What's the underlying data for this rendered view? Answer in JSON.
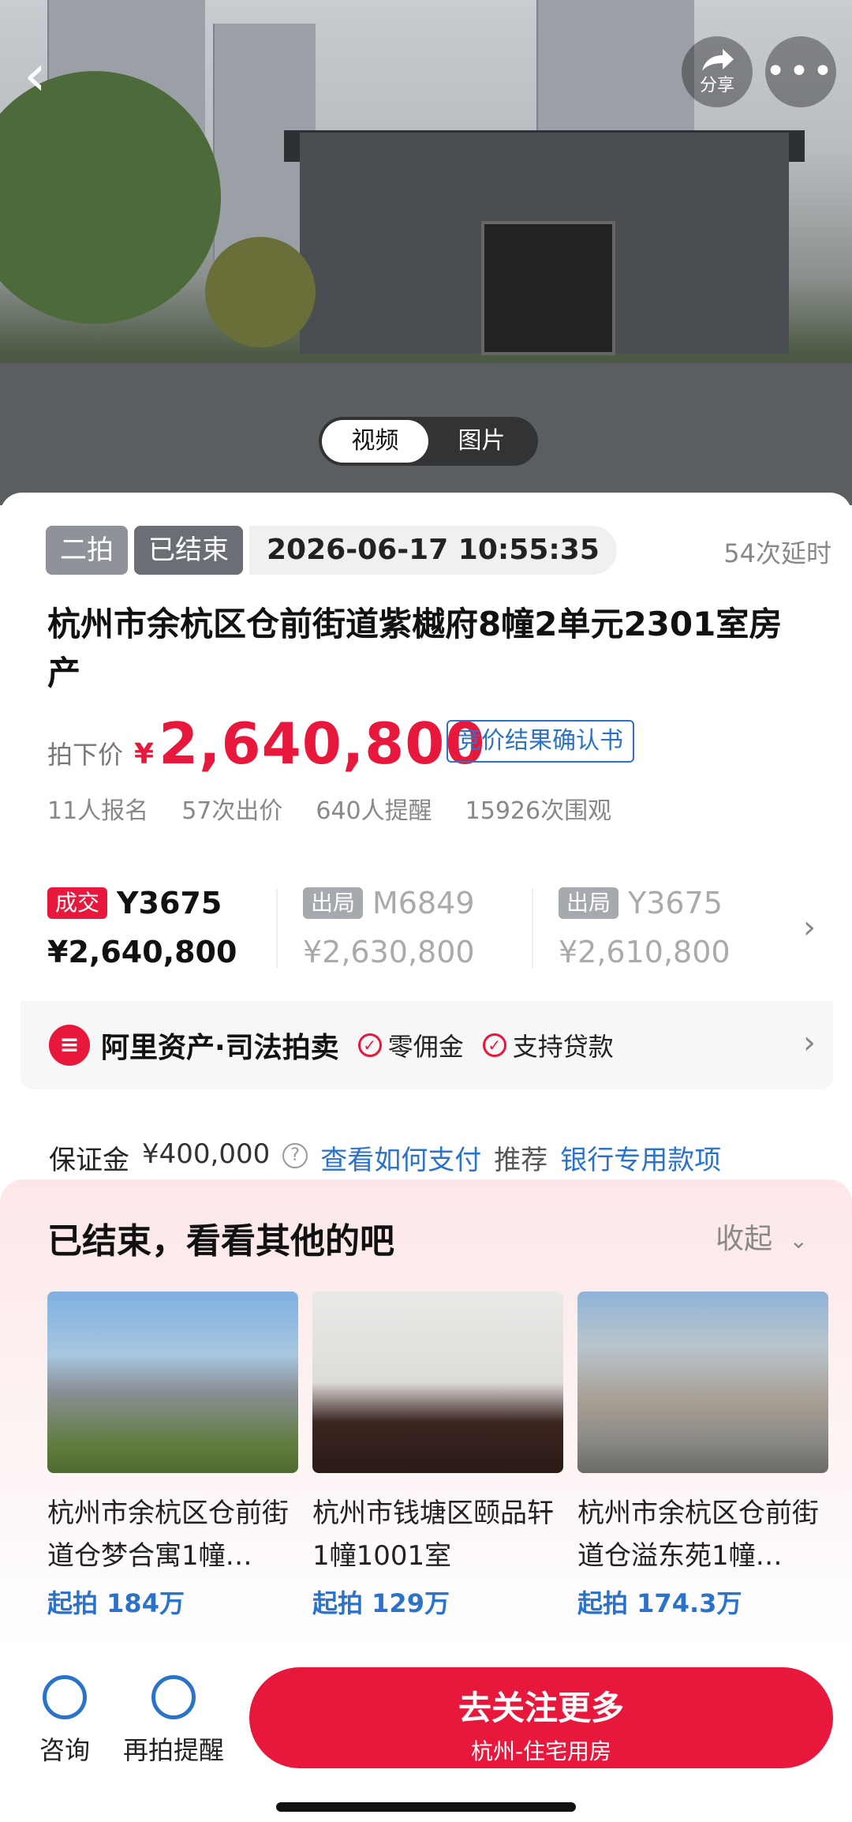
{
  "hero": {
    "share_label": "分享",
    "media_tabs": [
      "视频",
      "图片"
    ]
  },
  "auction": {
    "round_tag": "二拍",
    "status_tag": "已结束",
    "end_time": "2026-06-17 10:55:35",
    "extensions": "54次延时",
    "title": "杭州市余杭区仓前街道紫樾府8幢2单元2301室房产",
    "price_label": "拍下价",
    "currency": "¥",
    "price": "2,640,800",
    "certificate_link": "竞价结果确认书",
    "stats": [
      "11人报名",
      "57次出价",
      "640人提醒",
      "15926次围观"
    ]
  },
  "bids": [
    {
      "badge": "成交",
      "code": "Y3675",
      "price": "¥2,640,800"
    },
    {
      "badge": "出局",
      "code": "M6849",
      "price": "¥2,630,800"
    },
    {
      "badge": "出局",
      "code": "Y3675",
      "price": "¥2,610,800"
    }
  ],
  "brand": {
    "name": "阿里资产·司法拍卖",
    "features": [
      "零佣金",
      "支持贷款"
    ]
  },
  "deposit": {
    "label": "保证金",
    "amount": "¥400,000",
    "how_to_pay": "查看如何支付",
    "recommend_label": "推荐",
    "recommend_link": "银行专用款项"
  },
  "recommendations": {
    "title": "已结束，看看其他的吧",
    "collapse": "收起",
    "items": [
      {
        "name": "杭州市余杭区仓前街道仓梦合寓1幢…",
        "price_prefix": "起拍",
        "price": "184万"
      },
      {
        "name": "杭州市钱塘区颐品轩1幢1001室",
        "price_prefix": "起拍",
        "price": "129万"
      },
      {
        "name": "杭州市余杭区仓前街道仓溢东苑1幢…",
        "price_prefix": "起拍",
        "price": "174.3万"
      }
    ]
  },
  "bottom_bar": {
    "consult": "咨询",
    "remind": "再拍提醒",
    "cta_main": "去关注更多",
    "cta_sub": "杭州-住宅用房"
  },
  "colors": {
    "accent_red": "#e8173c",
    "link_blue": "#2b73c8"
  }
}
